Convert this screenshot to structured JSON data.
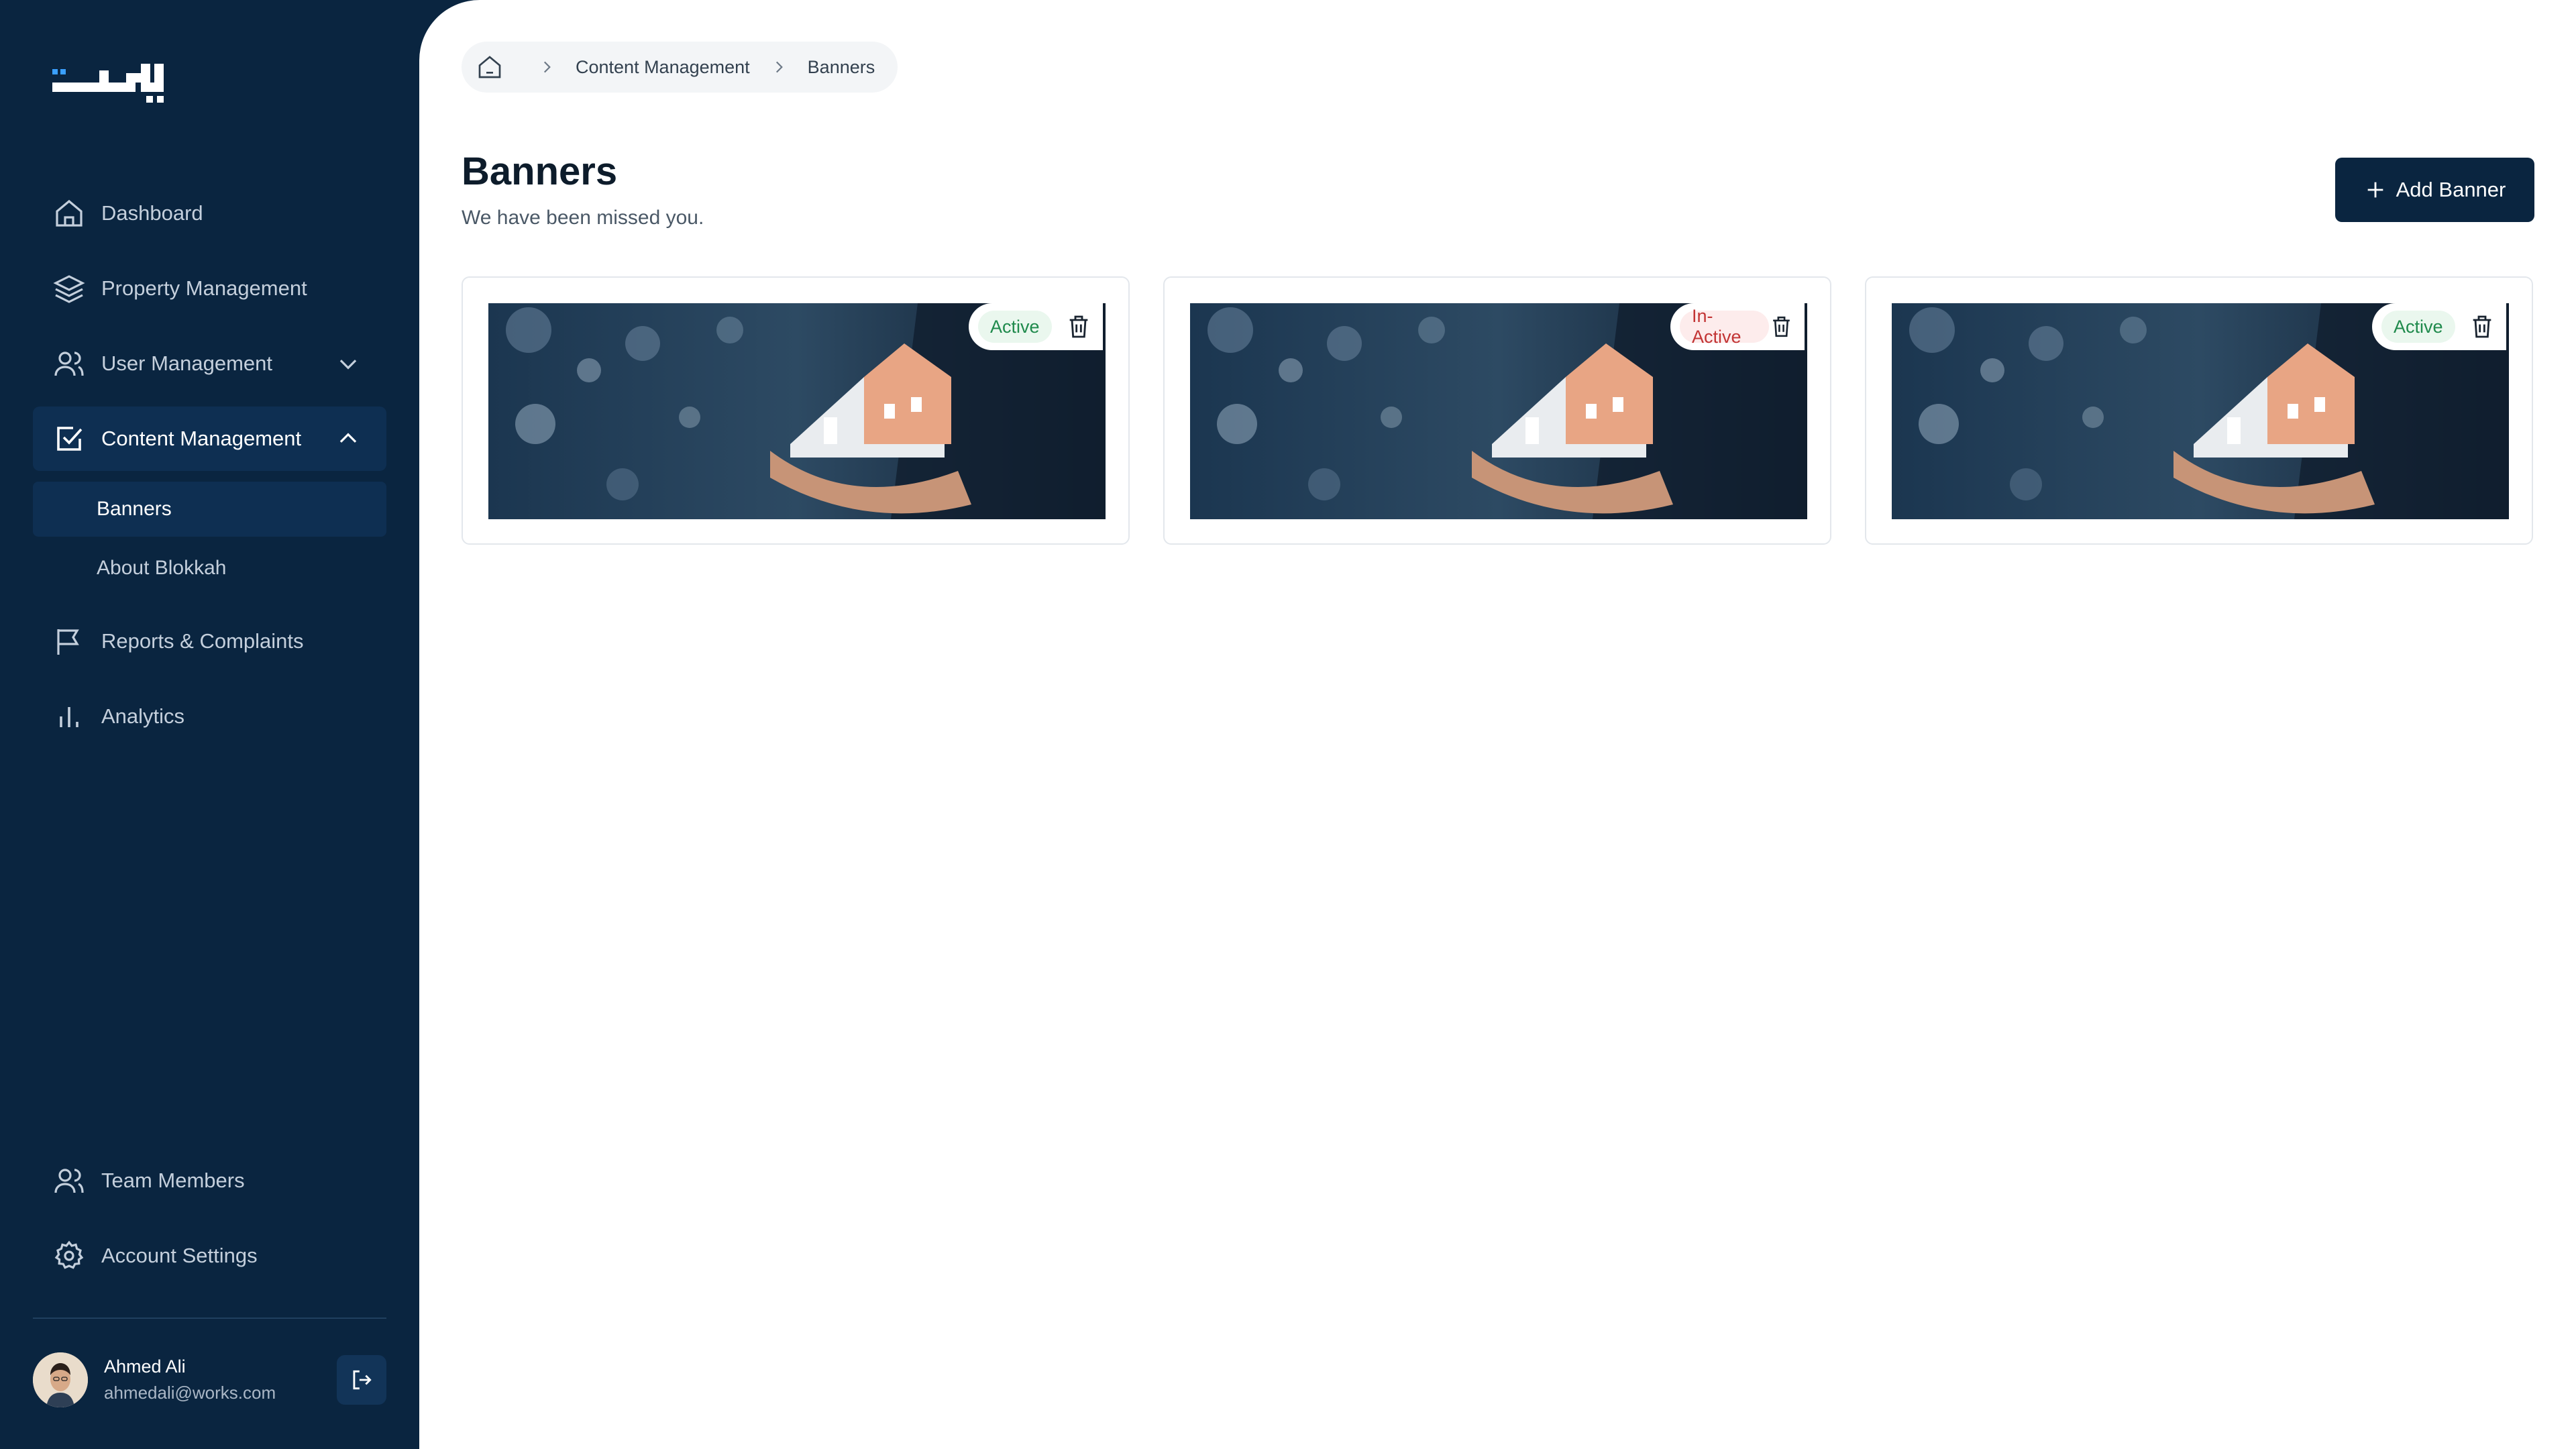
{
  "sidebar": {
    "nav": [
      {
        "label": "Dashboard",
        "icon": "home-icon"
      },
      {
        "label": "Property Management",
        "icon": "layers-icon"
      },
      {
        "label": "User Management",
        "icon": "users-icon"
      },
      {
        "label": "Content Management",
        "icon": "checkbox-icon"
      },
      {
        "label": "Reports & Complaints",
        "icon": "flag-icon"
      },
      {
        "label": "Analytics",
        "icon": "bar-chart-icon"
      }
    ],
    "sub_items": [
      {
        "label": "Banners"
      },
      {
        "label": "About Blokkah"
      }
    ],
    "bottom": [
      {
        "label": "Team Members",
        "icon": "users-icon"
      },
      {
        "label": "Account Settings",
        "icon": "gear-icon"
      }
    ],
    "user": {
      "name": "Ahmed Ali",
      "email": "ahmedali@works.com"
    }
  },
  "breadcrumb": {
    "items": [
      "Content Management",
      "Banners"
    ]
  },
  "page": {
    "title": "Banners",
    "subtitle": "We have been missed you."
  },
  "add_button": {
    "label": "Add Banner"
  },
  "banners": [
    {
      "status": "Active"
    },
    {
      "status": "In-Active"
    },
    {
      "status": "Active"
    }
  ],
  "colors": {
    "sidebar_bg": "#0a2540",
    "accent_dark": "#0a2540",
    "active_text": "#1f8a4c",
    "inactive_text": "#c23434"
  }
}
